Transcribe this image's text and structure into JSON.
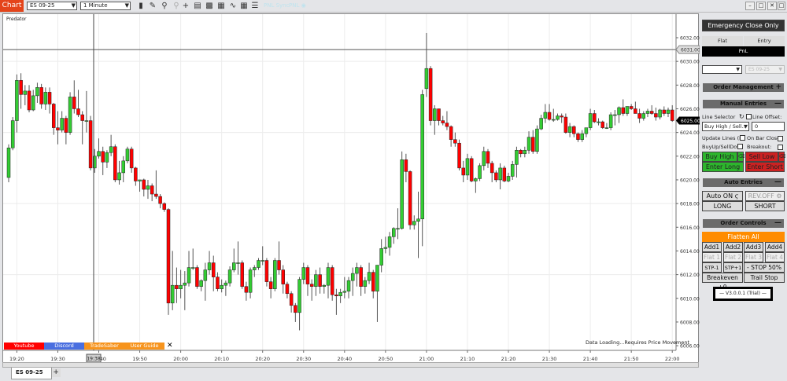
{
  "toolbar": {
    "chart_label": "Chart",
    "instrument": "ES 09-25",
    "interval": "1 Minute",
    "pnl_sync": "PNL Sync",
    "pnl": "PNL ◉",
    "icons": [
      "bar-type-icon",
      "pencil-icon",
      "zoom-in-icon",
      "zoom-out-icon",
      "crosshair-icon",
      "properties-icon",
      "strategy-icon",
      "chart-trader-icon",
      "indicator-icon",
      "template-icon",
      "data-box-icon"
    ]
  },
  "window": {
    "minimize": "–",
    "restore": "□",
    "close": "✕"
  },
  "chart": {
    "indicator_label": "Predator",
    "status": "Data Loading...Requires Price Movement",
    "links": [
      {
        "label": "Youtube",
        "color": "#ff0000"
      },
      {
        "label": "Discord",
        "color": "#4a6fe0"
      },
      {
        "label": "TradeSaber",
        "color": "#f7941d"
      },
      {
        "label": "User Guide",
        "color": "#f7941d"
      }
    ],
    "links_close": "✕",
    "crosshair_time": "19:38",
    "tab": "ES 09-25",
    "tab_add": "+"
  },
  "chart_data": {
    "type": "candlestick",
    "interval": "1 Minute",
    "start_time": "19:18",
    "ylim": [
      6006,
      6032
    ],
    "y_ticks": [
      "6006.00",
      "6008.00",
      "6010.00",
      "6012.00",
      "6014.00",
      "6016.00",
      "6018.00",
      "6020.00",
      "6022.00",
      "6024.00",
      "6026.00",
      "6028.00",
      "6030.00",
      "6032.00"
    ],
    "x_ticks": [
      "19:20",
      "19:30",
      "19:40",
      "19:50",
      "20:00",
      "20:10",
      "20:20",
      "20:30",
      "20:40",
      "20:50",
      "21:00",
      "21:10",
      "21:20",
      "21:30",
      "21:40",
      "21:50",
      "22:00"
    ],
    "hline": {
      "value": 6031,
      "label": "6031.00"
    },
    "last_price": {
      "value": 6025,
      "label": "6025.00"
    },
    "up_color": "#33cc33",
    "down_color": "#ff0000",
    "ohlc": [
      [
        6020.2,
        6023.0,
        6019.8,
        6022.7
      ],
      [
        6022.7,
        6025.3,
        6022.5,
        6025.0
      ],
      [
        6025.0,
        6028.9,
        6024.0,
        6028.4
      ],
      [
        6028.4,
        6029.0,
        6026.0,
        6027.2
      ],
      [
        6027.2,
        6028.0,
        6026.3,
        6027.5
      ],
      [
        6027.5,
        6028.0,
        6025.7,
        6025.9
      ],
      [
        6025.9,
        6027.6,
        6025.8,
        6027.1
      ],
      [
        6027.1,
        6028.2,
        6026.5,
        6027.8
      ],
      [
        6027.8,
        6028.1,
        6026.0,
        6026.4
      ],
      [
        6026.4,
        6027.8,
        6025.9,
        6027.4
      ],
      [
        6027.4,
        6027.8,
        6025.6,
        6026.4
      ],
      [
        6026.4,
        6026.5,
        6023.8,
        6024.4
      ],
      [
        6024.4,
        6025.8,
        6023.0,
        6024.2
      ],
      [
        6024.2,
        6025.8,
        6024.0,
        6025.2
      ],
      [
        6025.2,
        6025.4,
        6023.0,
        6024.0
      ],
      [
        6024.0,
        6027.4,
        6023.8,
        6027.0
      ],
      [
        6027.0,
        6028.4,
        6025.6,
        6026.0
      ],
      [
        6026.0,
        6027.6,
        6025.3,
        6025.5
      ],
      [
        6025.5,
        6025.8,
        6023.0,
        6025.0
      ],
      [
        6025.0,
        6027.5,
        6024.0,
        6025.0
      ],
      [
        6025.0,
        6025.4,
        6020.8,
        6021.0
      ],
      [
        6021.0,
        6022.6,
        6020.6,
        6022.0
      ],
      [
        6022.0,
        6023.5,
        6021.8,
        6022.4
      ],
      [
        6022.4,
        6022.8,
        6020.4,
        6021.5
      ],
      [
        6021.5,
        6022.5,
        6021.0,
        6022.3
      ],
      [
        6022.3,
        6023.8,
        6022.0,
        6022.8
      ],
      [
        6022.8,
        6023.0,
        6019.8,
        6020.0
      ],
      [
        6020.0,
        6021.6,
        6019.6,
        6020.6
      ],
      [
        6020.6,
        6022.0,
        6019.8,
        6021.6
      ],
      [
        6021.6,
        6022.8,
        6021.4,
        6022.6
      ],
      [
        6022.6,
        6022.8,
        6020.6,
        6021.0
      ],
      [
        6021.0,
        6021.1,
        6019.5,
        6019.9
      ],
      [
        6019.9,
        6020.0,
        6019.0,
        6020.0
      ],
      [
        6020.0,
        6020.1,
        6018.6,
        6019.2
      ],
      [
        6019.2,
        6020.0,
        6018.4,
        6019.5
      ],
      [
        6019.5,
        6019.7,
        6018.2,
        6018.8
      ],
      [
        6018.8,
        6020.8,
        6018.4,
        6018.6
      ],
      [
        6018.6,
        6018.8,
        6017.6,
        6018.0
      ],
      [
        6018.0,
        6018.1,
        6017.3,
        6017.5
      ],
      [
        6017.5,
        6017.6,
        6008.6,
        6009.6
      ],
      [
        6009.6,
        6014.0,
        6009.0,
        6011.1
      ],
      [
        6011.1,
        6012.6,
        6009.6,
        6010.8
      ],
      [
        6010.8,
        6012.4,
        6010.0,
        6011.1
      ],
      [
        6011.1,
        6012.3,
        6009.0,
        6011.3
      ],
      [
        6011.3,
        6014.0,
        6011.0,
        6012.6
      ],
      [
        6012.6,
        6014.2,
        6012.4,
        6012.6
      ],
      [
        6012.6,
        6012.8,
        6010.8,
        6011.0
      ],
      [
        6011.0,
        6011.6,
        6010.6,
        6011.5
      ],
      [
        6011.5,
        6013.0,
        6009.8,
        6012.4
      ],
      [
        6012.4,
        6014.0,
        6012.0,
        6013.0
      ],
      [
        6013.0,
        6013.6,
        6010.6,
        6011.8
      ],
      [
        6011.8,
        6012.2,
        6010.6,
        6010.8
      ],
      [
        6010.8,
        6011.6,
        6010.5,
        6011.1
      ],
      [
        6011.1,
        6011.5,
        6010.2,
        6011.3
      ],
      [
        6011.3,
        6012.7,
        6011.0,
        6012.4
      ],
      [
        6012.4,
        6014.2,
        6012.2,
        6013.0
      ],
      [
        6013.0,
        6014.8,
        6012.0,
        6013.0
      ],
      [
        6013.0,
        6013.2,
        6010.8,
        6011.0
      ],
      [
        6011.0,
        6011.4,
        6009.8,
        6010.5
      ],
      [
        6010.5,
        6012.6,
        6010.0,
        6012.4
      ],
      [
        6012.4,
        6012.8,
        6011.8,
        6012.6
      ],
      [
        6012.6,
        6013.4,
        6012.4,
        6013.2
      ],
      [
        6013.2,
        6014.4,
        6012.8,
        6013.2
      ],
      [
        6013.2,
        6013.4,
        6011.0,
        6011.4
      ],
      [
        6011.4,
        6011.8,
        6010.0,
        6010.8
      ],
      [
        6010.8,
        6013.4,
        6010.6,
        6013.2
      ],
      [
        6013.2,
        6014.8,
        6012.0,
        6012.4
      ],
      [
        6012.4,
        6012.8,
        6010.4,
        6011.2
      ],
      [
        6011.2,
        6011.4,
        6010.0,
        6010.4
      ],
      [
        6010.4,
        6010.6,
        6008.8,
        6009.4
      ],
      [
        6009.4,
        6009.6,
        6008.0,
        6008.8
      ],
      [
        6008.8,
        6011.8,
        6007.3,
        6011.6
      ],
      [
        6011.6,
        6013.0,
        6011.2,
        6012.6
      ],
      [
        6012.6,
        6012.8,
        6010.2,
        6011.2
      ],
      [
        6011.2,
        6011.6,
        6009.8,
        6011.0
      ],
      [
        6011.0,
        6012.4,
        6010.2,
        6012.0
      ],
      [
        6012.0,
        6012.6,
        6010.4,
        6011.0
      ],
      [
        6011.0,
        6011.2,
        6010.4,
        6011.1
      ],
      [
        6011.1,
        6013.0,
        6010.0,
        6012.6
      ],
      [
        6012.6,
        6012.8,
        6009.8,
        6010.3
      ],
      [
        6010.3,
        6010.8,
        6008.6,
        6010.2
      ],
      [
        6010.2,
        6010.8,
        6009.6,
        6010.5
      ],
      [
        6010.5,
        6011.8,
        6010.0,
        6010.6
      ],
      [
        6010.6,
        6011.8,
        6010.0,
        6011.5
      ],
      [
        6011.5,
        6012.6,
        6010.2,
        6012.1
      ],
      [
        6012.1,
        6013.0,
        6011.0,
        6012.6
      ],
      [
        6012.6,
        6012.8,
        6010.2,
        6011.0
      ],
      [
        6011.0,
        6011.8,
        6010.4,
        6011.5
      ],
      [
        6011.5,
        6013.0,
        6011.2,
        6012.2
      ],
      [
        6012.2,
        6012.4,
        6010.0,
        6010.6
      ],
      [
        6010.6,
        6012.8,
        6008.0,
        6012.8
      ],
      [
        6012.8,
        6015.0,
        6012.2,
        6014.2
      ],
      [
        6014.2,
        6015.2,
        6013.8,
        6014.3
      ],
      [
        6014.3,
        6015.6,
        6013.6,
        6015.2
      ],
      [
        6015.2,
        6016.0,
        6014.6,
        6015.9
      ],
      [
        6015.9,
        6017.6,
        6015.0,
        6015.9
      ],
      [
        6015.9,
        6022.4,
        6015.8,
        6021.7
      ],
      [
        6021.7,
        6022.2,
        6019.8,
        6020.7
      ],
      [
        6020.7,
        6020.8,
        6015.8,
        6016.2
      ],
      [
        6016.2,
        6017.0,
        6015.8,
        6016.5
      ],
      [
        6016.5,
        6019.0,
        6013.4,
        6016.7
      ],
      [
        6016.7,
        6027.6,
        6014.4,
        6027.2
      ],
      [
        6027.7,
        6032.4,
        6027.0,
        6029.4
      ],
      [
        6029.4,
        6029.6,
        6024.6,
        6025.0
      ],
      [
        6025.0,
        6026.3,
        6023.8,
        6026.0
      ],
      [
        6026.0,
        6026.0,
        6024.6,
        6025.0
      ],
      [
        6025.0,
        6025.4,
        6024.6,
        6024.8
      ],
      [
        6024.8,
        6025.8,
        6024.2,
        6024.5
      ],
      [
        6024.5,
        6024.6,
        6022.8,
        6023.4
      ],
      [
        6023.4,
        6024.0,
        6022.8,
        6023.1
      ],
      [
        6023.1,
        6023.4,
        6020.8,
        6021.0
      ],
      [
        6021.0,
        6021.6,
        6019.8,
        6020.4
      ],
      [
        6020.4,
        6022.2,
        6020.0,
        6021.8
      ],
      [
        6021.8,
        6022.0,
        6019.8,
        6019.9
      ],
      [
        6019.9,
        6020.2,
        6018.9,
        6020.1
      ],
      [
        6020.1,
        6021.4,
        6019.9,
        6021.2
      ],
      [
        6021.2,
        6022.8,
        6020.8,
        6022.4
      ],
      [
        6022.4,
        6022.6,
        6021.0,
        6021.4
      ],
      [
        6021.4,
        6021.6,
        6019.8,
        6020.6
      ],
      [
        6020.6,
        6020.8,
        6019.8,
        6020.0
      ],
      [
        6020.0,
        6021.4,
        6019.2,
        6021.0
      ],
      [
        6021.0,
        6021.2,
        6019.8,
        6019.9
      ],
      [
        6019.9,
        6020.6,
        6019.8,
        6020.3
      ],
      [
        6020.3,
        6021.6,
        6020.0,
        6021.3
      ],
      [
        6021.3,
        6022.8,
        6020.2,
        6022.5
      ],
      [
        6022.5,
        6022.6,
        6021.9,
        6022.2
      ],
      [
        6022.2,
        6022.8,
        6021.9,
        6022.5
      ],
      [
        6022.5,
        6024.1,
        6022.2,
        6023.6
      ],
      [
        6023.6,
        6024.2,
        6022.2,
        6022.4
      ],
      [
        6022.4,
        6024.6,
        6022.2,
        6024.3
      ],
      [
        6024.3,
        6025.5,
        6024.2,
        6025.2
      ],
      [
        6025.2,
        6026.4,
        6024.8,
        6025.7
      ],
      [
        6025.7,
        6026.4,
        6025.0,
        6025.1
      ],
      [
        6025.1,
        6026.0,
        6024.9,
        6025.1
      ],
      [
        6025.1,
        6025.6,
        6025.0,
        6025.4
      ],
      [
        6025.4,
        6025.6,
        6024.8,
        6025.3
      ],
      [
        6025.3,
        6025.6,
        6023.9,
        6024.0
      ],
      [
        6024.0,
        6024.8,
        6023.6,
        6024.5
      ],
      [
        6024.5,
        6024.6,
        6023.6,
        6023.9
      ],
      [
        6023.9,
        6024.0,
        6023.2,
        6023.4
      ],
      [
        6023.4,
        6024.2,
        6023.2,
        6023.9
      ],
      [
        6023.9,
        6024.4,
        6023.6,
        6024.4
      ],
      [
        6024.4,
        6026.0,
        6024.2,
        6025.6
      ],
      [
        6025.6,
        6025.9,
        6024.8,
        6024.9
      ],
      [
        6024.9,
        6025.2,
        6024.6,
        6024.9
      ],
      [
        6024.9,
        6025.0,
        6024.3,
        6024.4
      ],
      [
        6024.4,
        6024.8,
        6024.3,
        6024.4
      ],
      [
        6024.4,
        6025.7,
        6024.2,
        6025.5
      ],
      [
        6025.5,
        6025.9,
        6024.6,
        6025.5
      ],
      [
        6025.5,
        6026.2,
        6024.8,
        6026.1
      ],
      [
        6026.1,
        6026.8,
        6025.4,
        6025.6
      ],
      [
        6025.6,
        6026.2,
        6025.4,
        6026.2
      ],
      [
        6026.2,
        6026.4,
        6025.9,
        6026.0
      ],
      [
        6026.0,
        6026.6,
        6025.6,
        6025.6
      ],
      [
        6025.6,
        6026.0,
        6024.8,
        6025.2
      ],
      [
        6025.2,
        6025.8,
        6025.0,
        6025.6
      ],
      [
        6025.6,
        6026.0,
        6025.3,
        6025.8
      ],
      [
        6025.8,
        6026.3,
        6025.5,
        6025.6
      ],
      [
        6025.6,
        6026.1,
        6025.0,
        6025.3
      ],
      [
        6025.3,
        6026.0,
        6025.1,
        6025.9
      ],
      [
        6025.9,
        6026.2,
        6025.4,
        6025.6
      ],
      [
        6025.6,
        6026.1,
        6025.3,
        6025.9
      ],
      [
        6025.9,
        6026.3,
        6024.9,
        6025.0
      ]
    ]
  },
  "panel": {
    "emergency": "Emergency Close Only",
    "flat": "Flat",
    "entry": "Entry",
    "pnl": "PnL",
    "account_select": "",
    "instrument_select": "ES 09-25",
    "order_management": "Order Management",
    "manual_entries": "Manual Entries",
    "line_selector": "Line Selector",
    "line_offset": "Line Offset:",
    "line_mode": "Buy High / Sell...",
    "offset_value": "0",
    "update_lines": "Update Lines (B",
    "on_bar_close": "On Bar Close:",
    "buyup": "BuyUp/SellDow",
    "breakout": "Breakout:",
    "buy_high": "Buy High",
    "sell_low": "Sell Low",
    "enter_long": "Enter Long",
    "enter_short": "Enter Short",
    "auto_entries": "Auto Entries",
    "auto_on": "Auto ON",
    "rev_off": "REV.OFF",
    "long": "LONG",
    "short": "SHORT",
    "order_controls": "Order Controls",
    "flatten_all": "Flatten All",
    "add": [
      "Add1",
      "Add2",
      "Add3",
      "Add4"
    ],
    "flat_n": [
      "Flat 1",
      "Flat 2",
      "Flat 3",
      "Flat 4"
    ],
    "stp_minus": "STP-1",
    "stp_plus": "STP+1",
    "stop50": "- STOP 50% +",
    "breakeven": "Breakeven +0",
    "trail_stop": "Trail Stop",
    "version": "— V3.0.0.1 (Trial) —",
    "plus": "+",
    "minus": "—"
  }
}
